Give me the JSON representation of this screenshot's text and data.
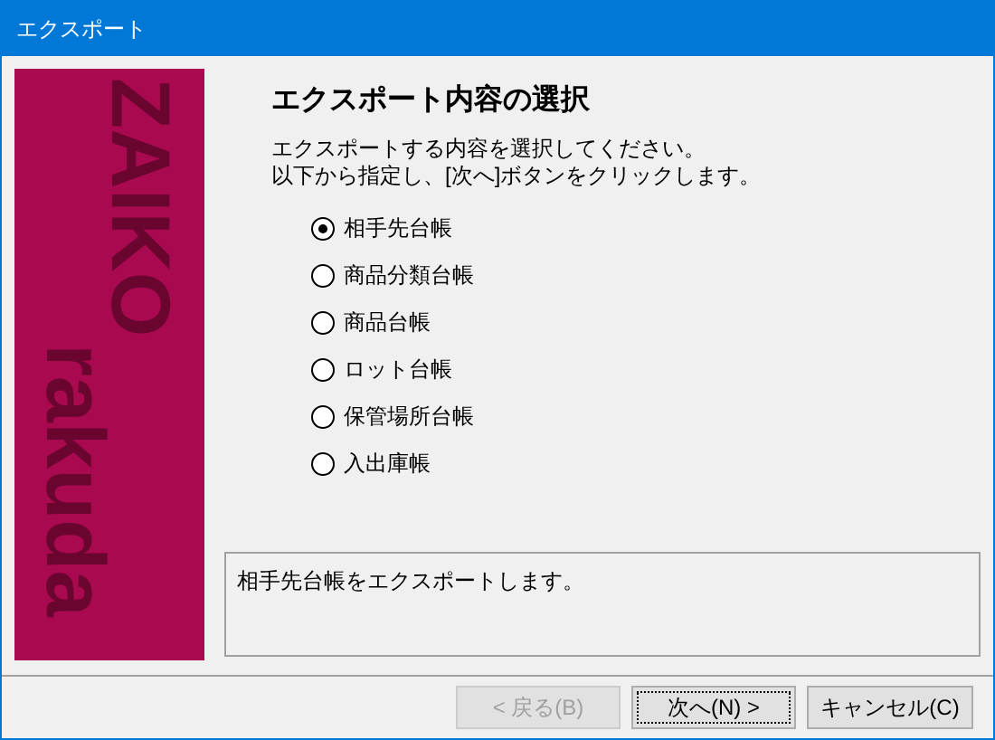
{
  "window": {
    "title": "エクスポート"
  },
  "banner": {
    "logo_top": "ZAIKO",
    "logo_bottom": "rakuda"
  },
  "heading": "エクスポート内容の選択",
  "instructions": [
    "エクスポートする内容を選択してください。",
    "以下から指定し、[次へ]ボタンをクリックします。"
  ],
  "options": [
    {
      "label": "相手先台帳",
      "selected": true
    },
    {
      "label": "商品分類台帳",
      "selected": false
    },
    {
      "label": "商品台帳",
      "selected": false
    },
    {
      "label": "ロット台帳",
      "selected": false
    },
    {
      "label": "保管場所台帳",
      "selected": false
    },
    {
      "label": "入出庫帳",
      "selected": false
    }
  ],
  "description": "相手先台帳をエクスポートします。",
  "buttons": [
    {
      "label": "< 戻る(B)",
      "disabled": true,
      "focused": false
    },
    {
      "label": "次へ(N) >",
      "disabled": false,
      "focused": true
    },
    {
      "label": "キャンセル(C)",
      "disabled": false,
      "focused": false
    }
  ]
}
